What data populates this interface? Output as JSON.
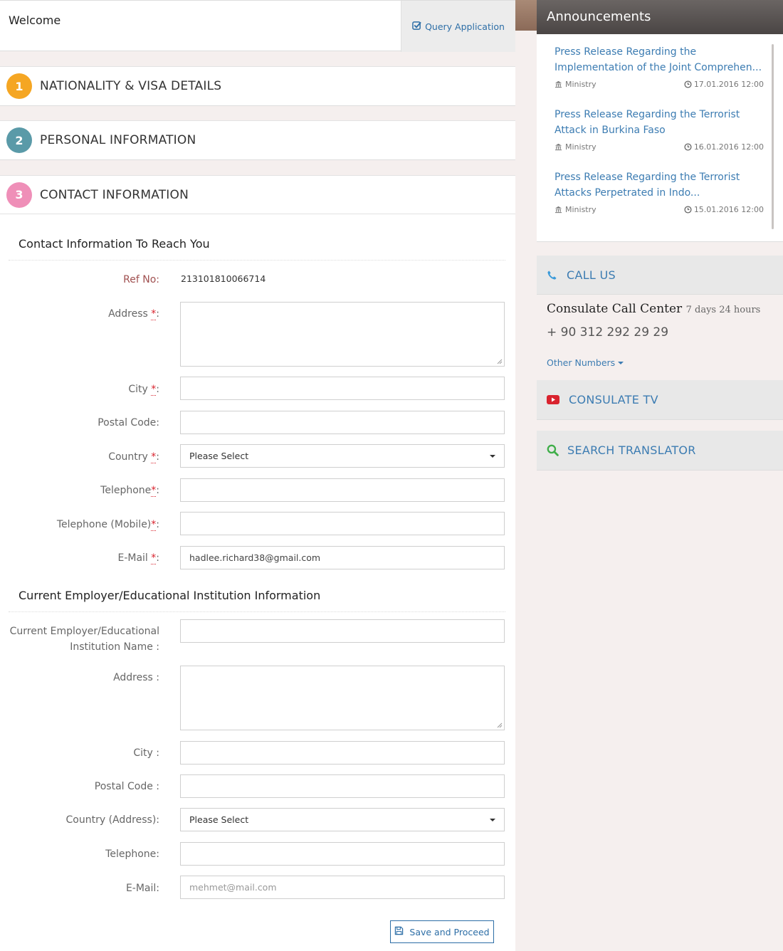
{
  "header": {
    "welcome": "Welcome",
    "query_button": "Query Application"
  },
  "steps": [
    {
      "number": "1",
      "title": "NATIONALITY & VISA DETAILS",
      "color": "#f5a623"
    },
    {
      "number": "2",
      "title": "PERSONAL INFORMATION",
      "color": "#5a9aa8"
    },
    {
      "number": "3",
      "title": "CONTACT INFORMATION",
      "color": "#ef8fb8"
    }
  ],
  "contact": {
    "section_title": "Contact Information To Reach You",
    "ref_label": "Ref No:",
    "ref_value": "213101810066714",
    "address_label": "Address",
    "city_label": "City",
    "postal_label": "Postal Code:",
    "country_label": "Country",
    "country_value": "Please Select",
    "telephone_label": "Telephone",
    "mobile_label": "Telephone (Mobile)",
    "email_label": "E-Mail",
    "email_value": "hadlee.richard38@gmail.com",
    "required_mark": "*",
    "colon": ":"
  },
  "employer": {
    "section_title": "Current Employer/Educational Institution Information",
    "name_label_line1": "Current Employer/Educational",
    "name_label_line2": "Institution Name :",
    "address_label": "Address :",
    "city_label": "City :",
    "postal_label": "Postal Code :",
    "country_label": "Country (Address):",
    "country_value": "Please Select",
    "telephone_label": "Telephone:",
    "email_label": "E-Mail:",
    "email_placeholder": "mehmet@mail.com"
  },
  "save_button": "Save and Proceed",
  "announcements": {
    "title": "Announcements",
    "items": [
      {
        "title": "Press Release Regarding the Implementation of the Joint Comprehen...",
        "source": "Ministry",
        "date": "17.01.2016 12:00"
      },
      {
        "title": "Press Release Regarding the Terrorist Attack in Burkina Faso",
        "source": "Ministry",
        "date": "16.01.2016 12:00"
      },
      {
        "title": "Press Release Regarding the Terrorist Attacks Perpetrated in Indo...",
        "source": "Ministry",
        "date": "15.01.2016 12:00"
      }
    ]
  },
  "call_us": {
    "label": "CALL US",
    "center": "Consulate Call Center",
    "hours": "7 days 24 hours",
    "phone": "+ 90 312 292 29 29",
    "other": "Other Numbers"
  },
  "consulate_tv": "CONSULATE TV",
  "search_translator": "SEARCH TRANSLATOR"
}
